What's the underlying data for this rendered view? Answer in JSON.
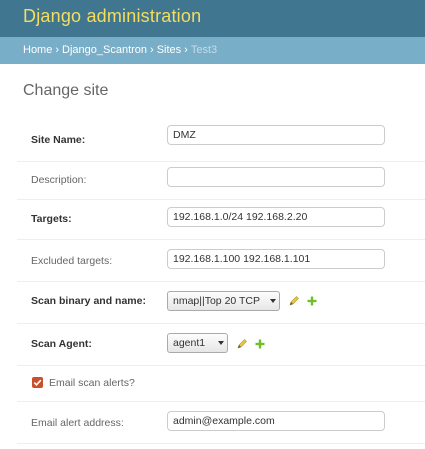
{
  "header": {
    "branding": "Django administration"
  },
  "breadcrumbs": [
    {
      "label": "Home"
    },
    {
      "label": "Django_Scantron"
    },
    {
      "label": "Sites"
    },
    {
      "label": "Test3"
    }
  ],
  "breadcrumb_separator": "›",
  "page_title": "Change site",
  "form": {
    "site_name": {
      "label": "Site Name:",
      "value": "DMZ"
    },
    "description": {
      "label": "Description:",
      "value": ""
    },
    "targets": {
      "label": "Targets:",
      "value": "192.168.1.0/24 192.168.2.20"
    },
    "excluded_targets": {
      "label": "Excluded targets:",
      "value": "192.168.1.100 192.168.1.101"
    },
    "scan_binary": {
      "label": "Scan binary and name:",
      "selected": "nmap||Top 20 TCP"
    },
    "scan_agent": {
      "label": "Scan Agent:",
      "selected": "agent1"
    },
    "email_scan_alerts": {
      "label": "Email scan alerts?",
      "checked": true
    },
    "email_alert_address": {
      "label": "Email alert address:",
      "value": "admin@example.com"
    }
  },
  "colors": {
    "header_bg": "#417690",
    "branding": "#f5dd5d",
    "breadcrumbs_bg": "#79aec8",
    "checkbox": "#c8502e",
    "edit_icon": "#e8c64a",
    "add_icon": "#70bf2b"
  },
  "icons": {
    "edit": "pencil-icon",
    "add": "plus-icon",
    "dropdown": "caret-down-icon",
    "checkbox": "checkmark-icon"
  }
}
